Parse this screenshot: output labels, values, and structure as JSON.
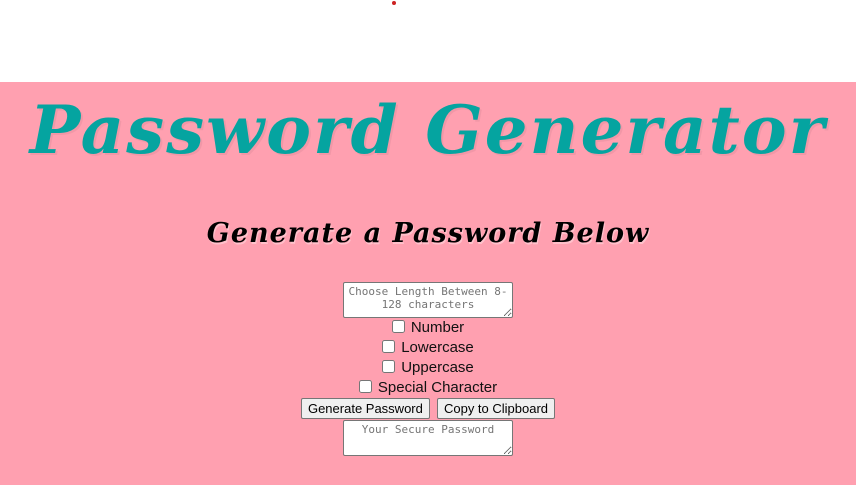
{
  "colors": {
    "panel_bg": "#ffa0b0",
    "title": "#05a4a0",
    "dot": "#cc2222"
  },
  "header": {
    "title": "Password Generator",
    "subtitle": "Generate a Password Below"
  },
  "form": {
    "length_placeholder": "Choose Length Between 8-128 characters",
    "options": [
      {
        "label": "Number",
        "checked": false
      },
      {
        "label": "Lowercase",
        "checked": false
      },
      {
        "label": "Uppercase",
        "checked": false
      },
      {
        "label": "Special Character",
        "checked": false
      }
    ],
    "generate_label": "Generate Password",
    "copy_label": "Copy to Clipboard",
    "output_placeholder": "Your Secure Password"
  }
}
